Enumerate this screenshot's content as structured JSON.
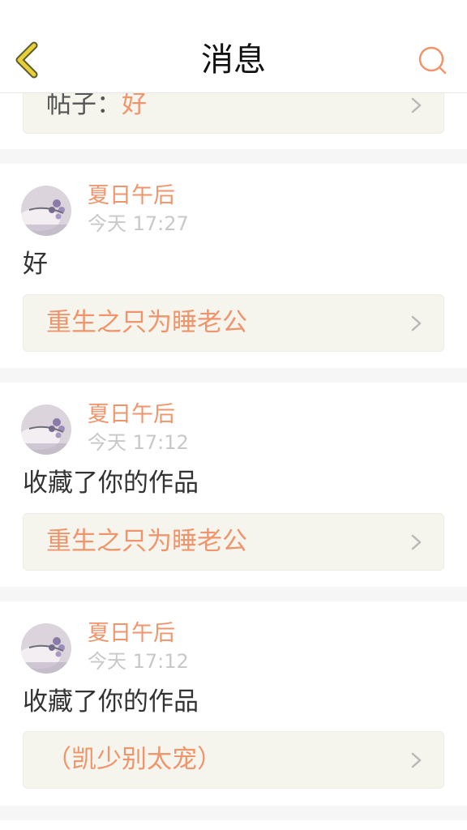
{
  "header": {
    "title": "消息",
    "back_icon": "chevron-left-icon",
    "search_icon": "search-icon"
  },
  "colors": {
    "accent": "#f0956b",
    "back": "#e8cf3a",
    "link_bg": "#f5f5ee",
    "timestamp": "#c8c8c8"
  },
  "top_item": {
    "prefix": "帖子：",
    "value": "好"
  },
  "messages": [
    {
      "user": "夏日午后",
      "time": "今天 17:27",
      "text": "好",
      "link": "重生之只为睡老公"
    },
    {
      "user": "夏日午后",
      "time": "今天 17:12",
      "text": "收藏了你的作品",
      "link": "重生之只为睡老公"
    },
    {
      "user": "夏日午后",
      "time": "今天 17:12",
      "text": "收藏了你的作品",
      "link": "（凯少别太宠）"
    }
  ]
}
